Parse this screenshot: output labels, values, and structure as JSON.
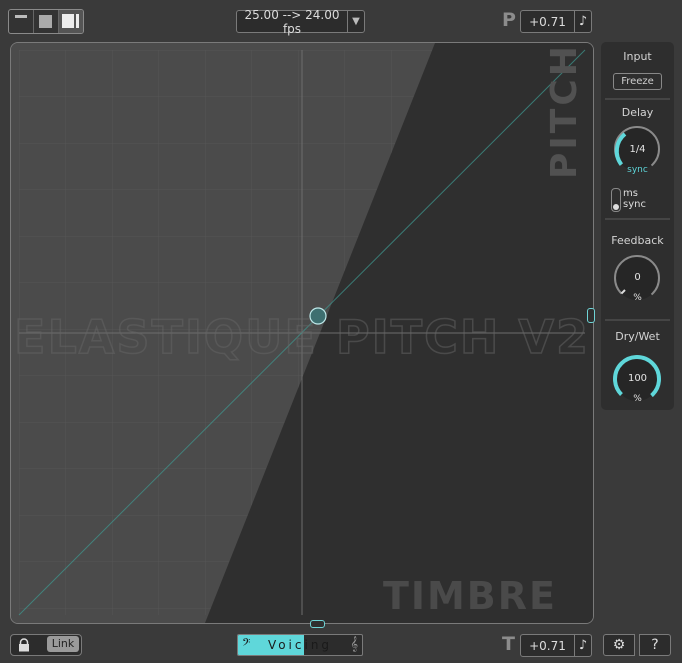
{
  "topbar": {
    "view_buttons": [
      "minimal-view",
      "compact-view",
      "full-view"
    ],
    "fps_text": "25.00 --> 24.00 fps",
    "fps_dropdown_icon": "▼",
    "pitch_letter": "P",
    "pitch_value": "+0.71",
    "note_icon": "♪"
  },
  "main": {
    "watermark": "ELASTIQUE PITCH V2",
    "pitch_label": "PITCH",
    "timbre_label": "TIMBRE"
  },
  "side": {
    "input_label": "Input",
    "freeze_label": "Freeze",
    "delay_label": "Delay",
    "delay_value": "1/4",
    "delay_unit": "sync",
    "delay_level": 0.55,
    "ms_label": "ms",
    "sync_label": "sync",
    "feedback_label": "Feedback",
    "feedback_value": "0",
    "feedback_unit": "%",
    "feedback_level": 0,
    "drywet_label": "Dry/Wet",
    "drywet_value": "100",
    "drywet_unit": "%",
    "drywet_level": 1.0
  },
  "bottom": {
    "link_label": "Link",
    "voicing_label": "Voicing",
    "bass_clef": "𝄢",
    "treble_clef": "𝄞",
    "timbre_letter": "T",
    "timbre_value": "+0.71",
    "note_icon": "♪",
    "settings_icon": "⚙",
    "help_icon": "?"
  },
  "colors": {
    "accent": "#5fd7da",
    "panel_light": "#4a4a4a",
    "panel_dark": "#2f2f2f",
    "background": "#3a3a3a"
  }
}
